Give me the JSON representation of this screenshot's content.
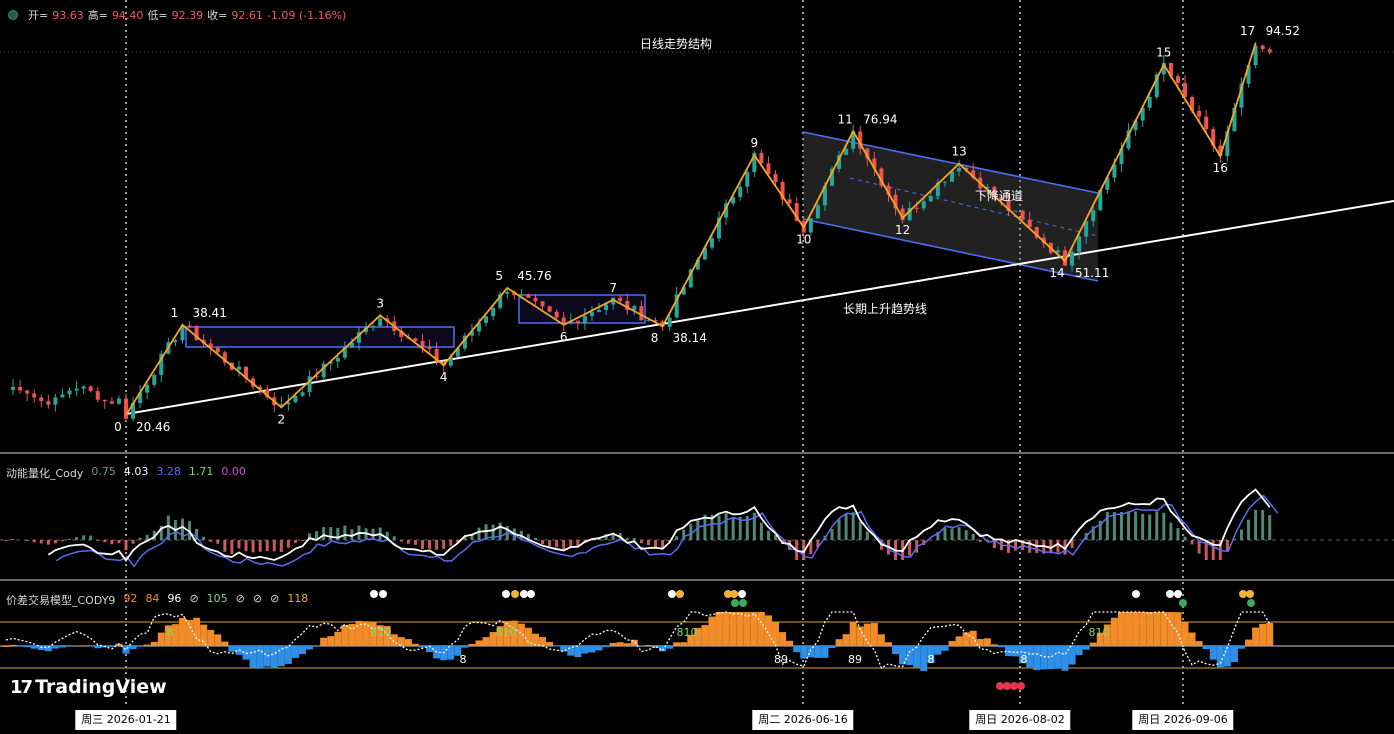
{
  "header": {
    "open_label": "开=",
    "open": "93.63",
    "high_label": "高=",
    "high": "94.40",
    "low_label": "低=",
    "low": "92.39",
    "close_label": "收=",
    "close": "92.61",
    "change": "-1.09 (-1.16%)"
  },
  "main": {
    "title": "日线走势结构",
    "channel_label": "下降通道",
    "trendline_label": "长期上升趋势线",
    "pivots": [
      {
        "n": "0",
        "price": "20.46"
      },
      {
        "n": "1",
        "price": "38.41"
      },
      {
        "n": "2"
      },
      {
        "n": "3"
      },
      {
        "n": "4"
      },
      {
        "n": "5",
        "price": "45.76"
      },
      {
        "n": "6"
      },
      {
        "n": "7"
      },
      {
        "n": "8",
        "price": "38.14"
      },
      {
        "n": "9"
      },
      {
        "n": "10"
      },
      {
        "n": "11",
        "price": "76.94"
      },
      {
        "n": "12"
      },
      {
        "n": "13"
      },
      {
        "n": "14",
        "price": "51.11"
      },
      {
        "n": "15"
      },
      {
        "n": "16"
      },
      {
        "n": "17",
        "price": "94.52"
      }
    ]
  },
  "indicator1": {
    "name": "动能量化_Cody",
    "values": [
      "0.75",
      "4.03",
      "3.28",
      "1.71",
      "0.00"
    ],
    "colors": [
      "#5fa08a",
      "#ffffff",
      "#5b6cf0",
      "#7ddc6a",
      "#d24bd2"
    ]
  },
  "indicator2": {
    "name": "价差交易模型_CODY9",
    "values": [
      "92",
      "84",
      "96",
      "⊘",
      "105",
      "⊘",
      "⊘",
      "⊘",
      "118"
    ],
    "colors": [
      "#f28c28",
      "#f28c28",
      "#ffffff",
      "#d8d8d8",
      "#7ddc6a",
      "#d8d8d8",
      "#d8d8d8",
      "#d8d8d8",
      "#f2b233"
    ],
    "pane_labels": [
      "8",
      "810",
      "810",
      "810",
      "8",
      "89",
      "89",
      "8",
      "8",
      "810"
    ]
  },
  "date_labels": [
    "周三 2026-01-21",
    "周二 2026-06-16",
    "周日 2026-08-02",
    "周日 2026-09-06"
  ],
  "logo_text": "TradingView",
  "colors": {
    "up": "#26a69a",
    "down": "#ef5350",
    "zigzag": "#f5a623",
    "channel": "#4c6ef5",
    "trend": "#ffffff"
  },
  "chart_data": {
    "type": "candlestick",
    "title": "日线走势结构",
    "price_range": [
      16,
      100
    ],
    "zigzag": [
      {
        "point": "0",
        "date_index": 0,
        "price": 20.46
      },
      {
        "point": "1",
        "date_index": 8,
        "price": 38.41
      },
      {
        "point": "2",
        "date_index": 22,
        "price": 22.0
      },
      {
        "point": "3",
        "date_index": 36,
        "price": 40.3
      },
      {
        "point": "4",
        "date_index": 45,
        "price": 30.4
      },
      {
        "point": "5",
        "date_index": 54,
        "price": 45.76
      },
      {
        "point": "6",
        "date_index": 62,
        "price": 38.4
      },
      {
        "point": "7",
        "date_index": 69,
        "price": 43.4
      },
      {
        "point": "8",
        "date_index": 76,
        "price": 38.14
      },
      {
        "point": "9",
        "date_index": 89,
        "price": 72.2
      },
      {
        "point": "10",
        "date_index": 96,
        "price": 57.8
      },
      {
        "point": "11",
        "date_index": 103,
        "price": 76.94
      },
      {
        "point": "12",
        "date_index": 110,
        "price": 59.7
      },
      {
        "point": "13",
        "date_index": 118,
        "price": 70.5
      },
      {
        "point": "14",
        "date_index": 133,
        "price": 51.11
      },
      {
        "point": "15",
        "date_index": 147,
        "price": 90.2
      },
      {
        "point": "16",
        "date_index": 155,
        "price": 72.0
      },
      {
        "point": "17",
        "date_index": 160,
        "price": 94.52
      }
    ],
    "last_bar": {
      "open": 93.63,
      "high": 94.4,
      "low": 92.39,
      "close": 92.61,
      "change": -1.09,
      "change_pct": -1.16
    }
  }
}
